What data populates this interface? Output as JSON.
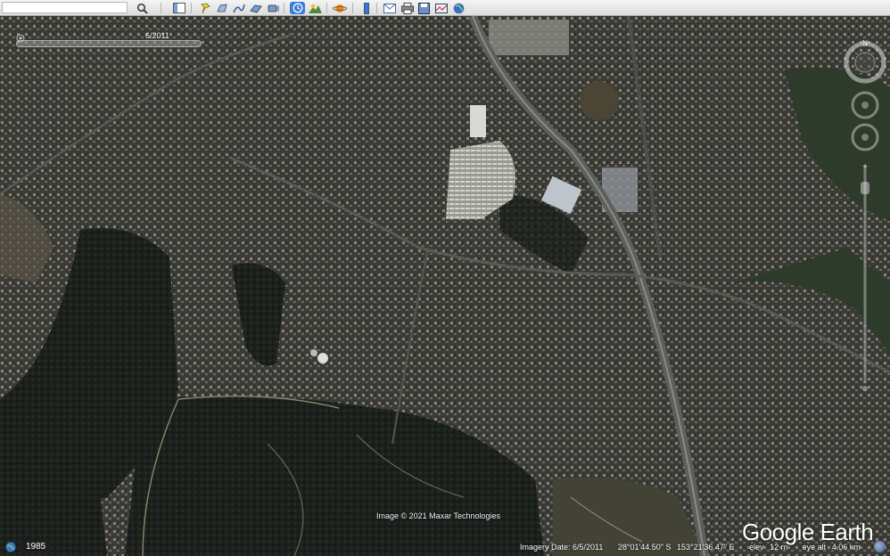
{
  "toolbar": {
    "search_placeholder": "",
    "buttons": [
      "search-icon",
      "separator",
      "sidebar-icon",
      "placemark-icon",
      "polygon-icon",
      "path-icon",
      "image-overlay-icon",
      "tour-icon",
      "historical-imagery-icon",
      "sun-icon",
      "planets-icon",
      "ruler-icon",
      "email-icon",
      "print-icon",
      "save-image-icon",
      "map-view-icon",
      "earth-gallery-icon"
    ]
  },
  "time_slider": {
    "date_label": "6/2011"
  },
  "navigation": {
    "north_label": "N"
  },
  "map": {
    "attribution": "Image © 2021 Maxar Technologies",
    "logo_text": "Google Earth"
  },
  "status": {
    "year": "1985",
    "imagery_date": "Imagery Date: 6/5/2011",
    "latitude": "28°01'44.50\" S",
    "longitude": "153°21'36.47\" E",
    "elev_label": "elev",
    "elev_value": "12 m",
    "eye_alt_label": "eye alt",
    "eye_alt_value": "4.06 km"
  },
  "colors": {
    "accent": "#3a7bd5",
    "toolbar_bg": "#e6e6e6"
  }
}
